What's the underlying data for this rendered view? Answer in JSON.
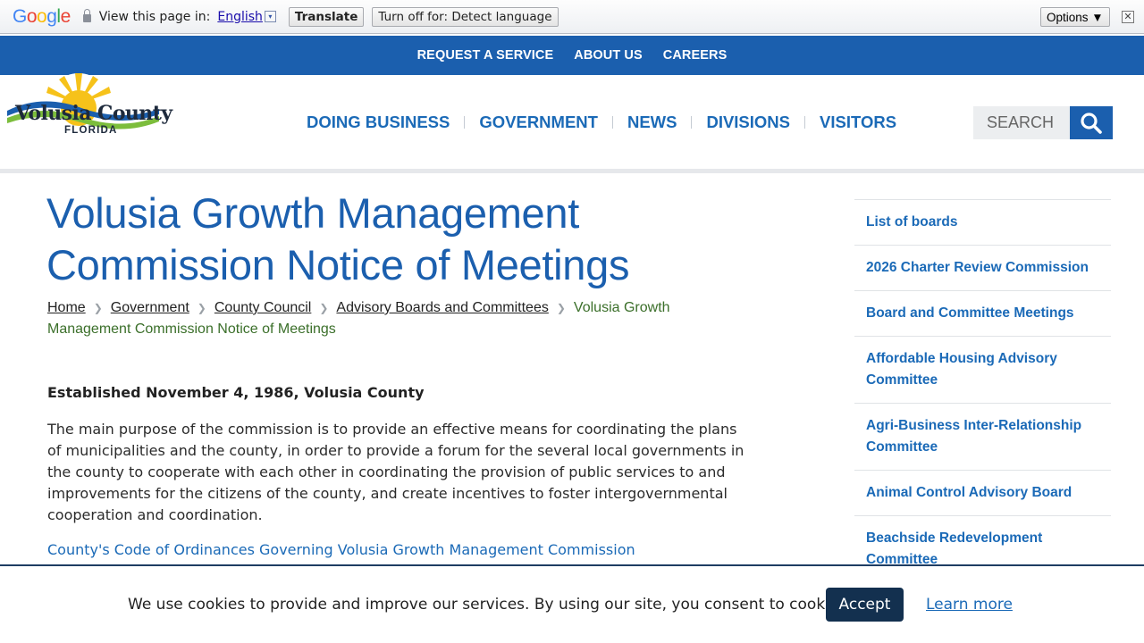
{
  "translate_bar": {
    "logo": "Google",
    "view_label": "View this page in:",
    "language": "English",
    "dropdown_glyph": "▾",
    "translate_button": "Translate",
    "turn_off_button": "Turn off for: Detect language",
    "options_button": "Options ▼",
    "close_glyph": "✕"
  },
  "top_nav": {
    "items": [
      "REQUEST A SERVICE",
      "ABOUT US",
      "CAREERS"
    ]
  },
  "header": {
    "logo_name": "Volusia County",
    "logo_state": "FLORIDA",
    "nav": [
      "DOING BUSINESS",
      "GOVERNMENT",
      "NEWS",
      "DIVISIONS",
      "VISITORS"
    ],
    "search_placeholder": "SEARCH"
  },
  "main": {
    "title": "Volusia Growth Management Commission Notice of Meetings",
    "breadcrumb": [
      "Home",
      "Government",
      "County Council",
      "Advisory Boards and Committees"
    ],
    "breadcrumb_current": "Volusia Growth Management Commission Notice of Meetings",
    "established": "Established November 4, 1986, Volusia County",
    "purpose": "The main purpose of the commission is to provide an effective means for coordinating the plans of municipalities and the county, in order to provide a forum for the several local governments in the county to cooperate with each other in coordinating the provision of public services to and improvements for the citizens of the county, and create incentives to foster intergovernmental cooperation and coordination.",
    "code_link": "County's Code of Ordinances Governing Volusia Growth Management Commission"
  },
  "sidebar": {
    "items": [
      "List of boards",
      "2026 Charter Review Commission",
      "Board and Committee Meetings",
      "Affordable Housing Advisory Committee",
      "Agri-Business Inter-Relationship Committee",
      "Animal Control Advisory Board",
      "Beachside Redevelopment Committee"
    ]
  },
  "cookie": {
    "text": "We use cookies to provide and improve our services. By using our site, you consent to cookies.",
    "accept": "Accept",
    "learn_more": "Learn more"
  },
  "colors": {
    "brand_blue": "#1b5fae",
    "link_blue": "#1b6ab7",
    "breadcrumb_current": "#3b6f2a",
    "cookie_button": "#13304f"
  },
  "icons": {
    "search_button": "search-icon",
    "breadcrumb_separator": "chevron-right-icon",
    "translate_lock": "lock-icon"
  }
}
